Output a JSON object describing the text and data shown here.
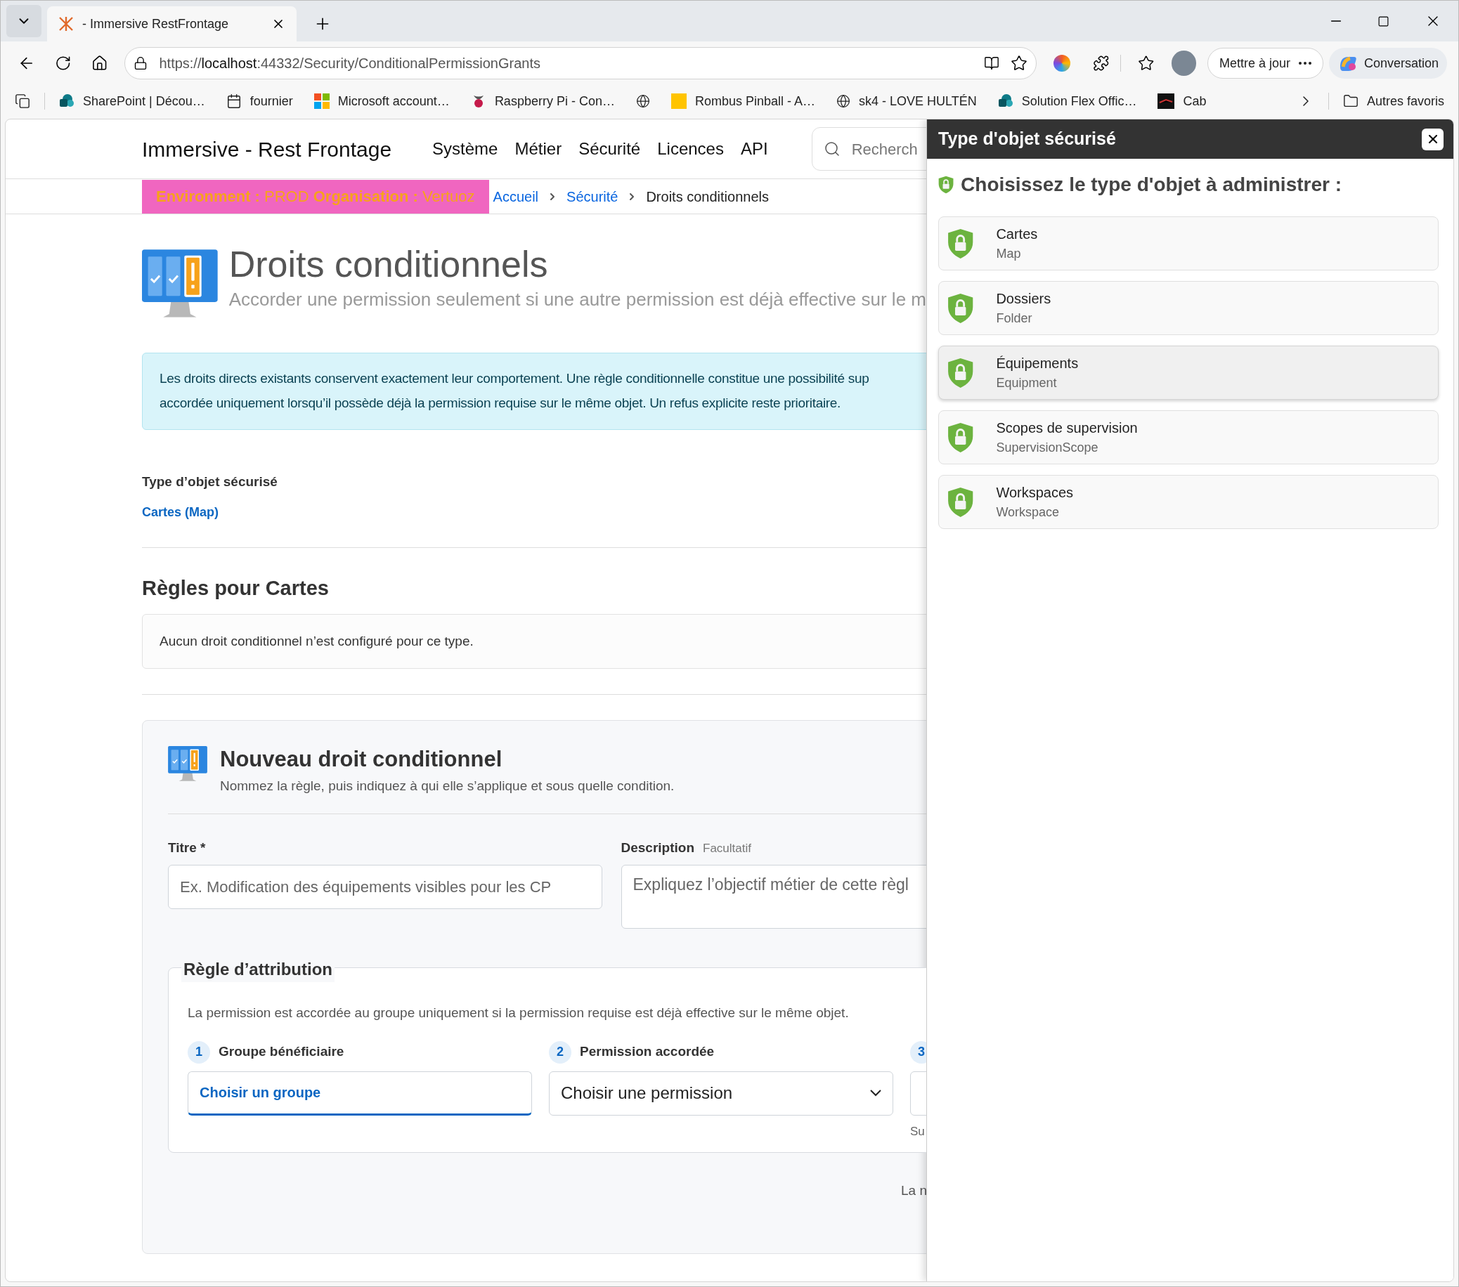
{
  "browser": {
    "tab_title": "- Immersive RestFrontage",
    "url_scheme": "https://",
    "url_host": "localhost",
    "url_path": ":44332/Security/ConditionalPermissionGrants",
    "update_button": "Mettre à jour",
    "copilot_button": "Conversation",
    "other_favorites": "Autres favoris",
    "bookmarks": [
      {
        "kind": "sharepoint",
        "label": "SharePoint | Décou…"
      },
      {
        "kind": "calendar",
        "label": "fournier"
      },
      {
        "kind": "microsoft",
        "label": "Microsoft account…"
      },
      {
        "kind": "raspberry",
        "label": "Raspberry Pi - Con…"
      },
      {
        "kind": "globe"
      },
      {
        "kind": "square",
        "label": "Rombus Pinball - A…"
      },
      {
        "kind": "globe",
        "label": "sk4 - LOVE HULTÉN"
      },
      {
        "kind": "sharepoint",
        "label": "Solution Flex Offic…"
      },
      {
        "kind": "dark",
        "label": "Cab"
      }
    ]
  },
  "header": {
    "brand": "Immersive - Rest Frontage",
    "nav": [
      "Système",
      "Métier",
      "Sécurité",
      "Licences",
      "API"
    ],
    "search_placeholder": "Recherch"
  },
  "env_banner": [
    {
      "label": "Environment :",
      "value": "PROD"
    },
    {
      "label": "Organisation :",
      "value": "Vertuoz"
    }
  ],
  "breadcrumb": [
    {
      "label": "Accueil",
      "link": true
    },
    {
      "label": "Sécurité",
      "link": true
    },
    {
      "label": "Droits conditionnels",
      "link": false
    }
  ],
  "page": {
    "title": "Droits conditionnels",
    "subtitle": "Accorder une permission seulement si une autre permission est déjà effective sur le m",
    "info_alert": [
      "Les droits directs existants conservent exactement leur comportement. Une règle conditionnelle constitue une possibilité sup",
      "accordée uniquement lorsqu’il possède déjà la permission requise sur le même objet. Un refus explicite reste prioritaire."
    ],
    "object_type_label": "Type d’objet sécurisé",
    "object_type_value": "Cartes (Map)",
    "rules_heading": "Règles pour Cartes",
    "rules_empty": "Aucun droit conditionnel n’est configuré pour ce type."
  },
  "new_rule": {
    "title": "Nouveau droit conditionnel",
    "subtitle": "Nommez la règle, puis indiquez à qui elle s’applique et sous quelle condition.",
    "title_label": "Titre *",
    "title_placeholder": "Ex. Modification des équipements visibles pour les CP",
    "description_label": "Description",
    "description_hint": "Facultatif",
    "description_placeholder": "Expliquez l’objectif métier de cette règl",
    "legend": "Règle d’attribution",
    "text": "La permission est accordée au groupe uniquement si la permission requise est déjà effective sur le même objet.",
    "steps": [
      {
        "number": "1",
        "label": "Groupe bénéficiaire",
        "kind": "picker",
        "value": "Choisir un groupe"
      },
      {
        "number": "2",
        "label": "Permission accordée",
        "kind": "select",
        "value": "Choisir une permission"
      },
      {
        "number": "3",
        "kind": "cut",
        "hint": "Su"
      }
    ],
    "footer_note": "La n"
  },
  "drawer": {
    "title": "Type d'objet sécurisé",
    "heading": "Choisissez le type d'objet à administrer :",
    "items": [
      {
        "title": "Cartes",
        "subtitle": "Map",
        "selected": false
      },
      {
        "title": "Dossiers",
        "subtitle": "Folder",
        "selected": false
      },
      {
        "title": "Équipements",
        "subtitle": "Equipment",
        "selected": true
      },
      {
        "title": "Scopes de supervision",
        "subtitle": "SupervisionScope",
        "selected": false
      },
      {
        "title": "Workspaces",
        "subtitle": "Workspace",
        "selected": false
      }
    ]
  }
}
